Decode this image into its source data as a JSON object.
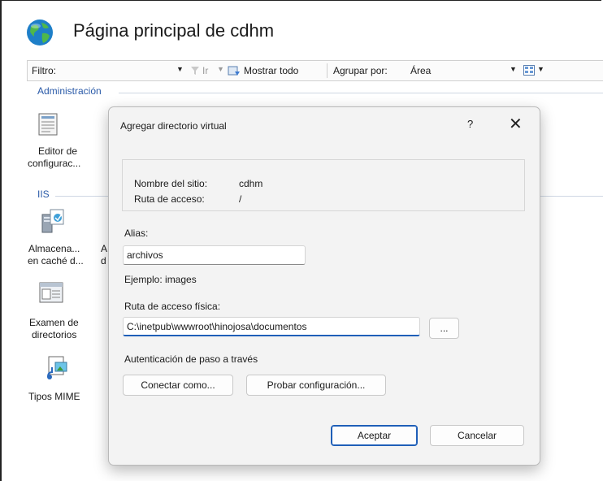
{
  "header": {
    "title": "Página principal de cdhm",
    "icon": "globe-icon"
  },
  "toolbar": {
    "filter_label": "Filtro:",
    "go_label": "Ir",
    "show_all_label": "Mostrar todo",
    "group_by_label": "Agrupar por:",
    "group_by_value": "Área"
  },
  "groups": {
    "admin": "Administración",
    "iis": "IIS"
  },
  "features": {
    "config_editor_line1": "Editor de",
    "config_editor_line2": "configurac...",
    "cache_line1": "Almacena...",
    "cache_line2": "en caché d...",
    "hidden_a_line1": "A",
    "hidden_a_line2": "d",
    "browse_line1": "Examen de",
    "browse_line2": "directorios",
    "mime": "Tipos MIME"
  },
  "dialog": {
    "title": "Agregar directorio virtual",
    "help": "?",
    "close": "✕",
    "site_name_label": "Nombre del sitio:",
    "site_name_value": "cdhm",
    "path_label": "Ruta de acceso:",
    "path_value": "/",
    "alias_label": "Alias:",
    "alias_value": "archivos",
    "example": "Ejemplo: images",
    "physical_path_label": "Ruta de acceso física:",
    "physical_path_value": "C:\\inetpub\\wwwroot\\hinojosa\\documentos",
    "browse_button": "...",
    "passthrough_label": "Autenticación de paso a través",
    "connect_as_button": "Conectar como...",
    "test_settings_button": "Probar configuración...",
    "ok_button": "Aceptar",
    "cancel_button": "Cancelar"
  },
  "colors": {
    "accent": "#1f5fb8",
    "group_label": "#2a5aa8"
  }
}
